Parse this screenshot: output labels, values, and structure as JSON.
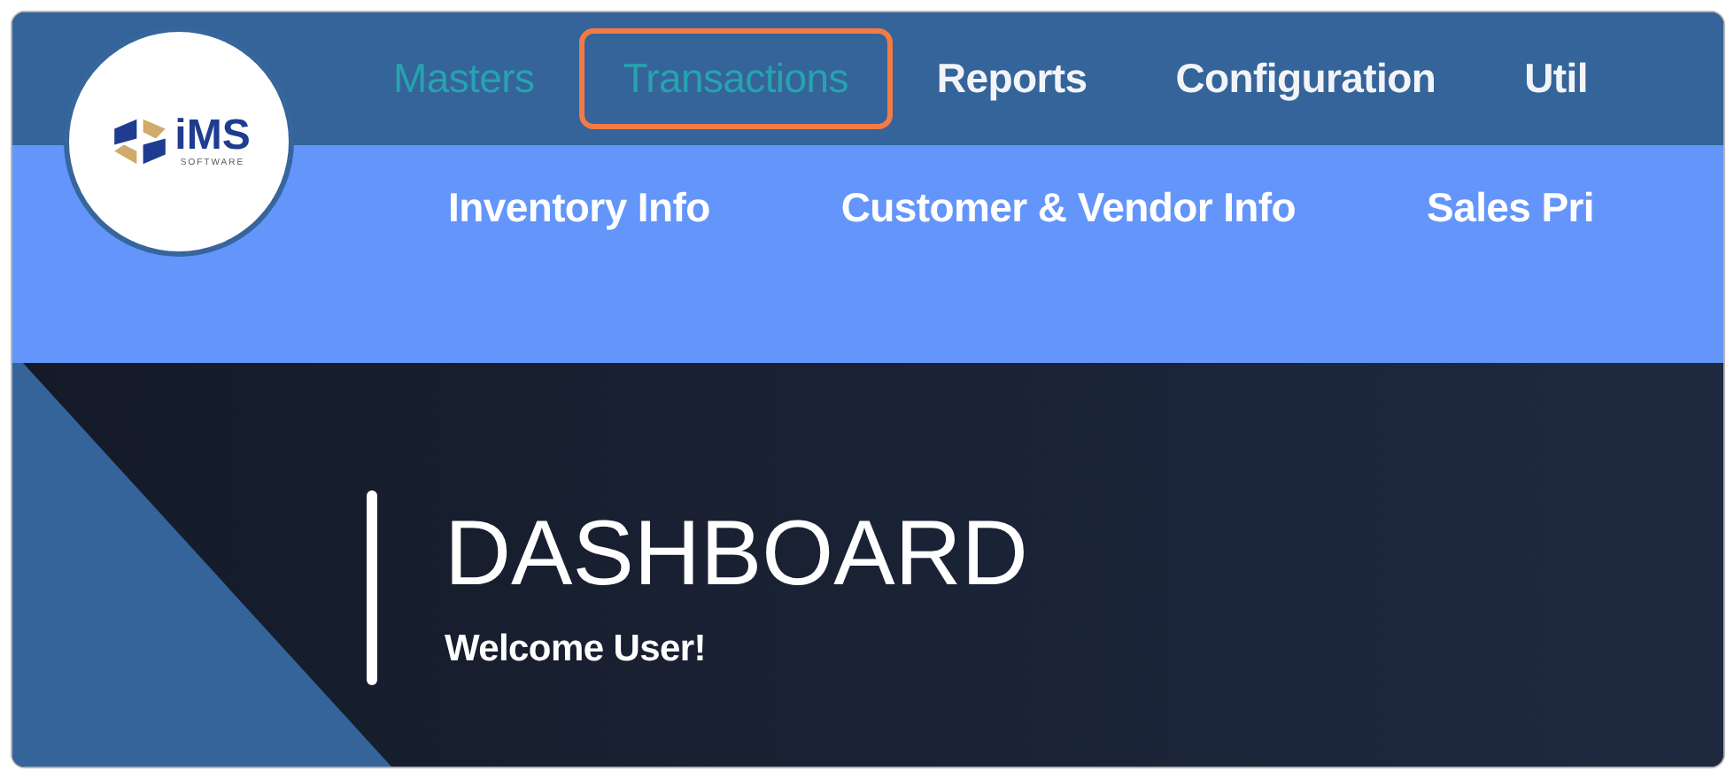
{
  "logo": {
    "name": "iMS",
    "tagline": "SOFTWARE"
  },
  "main_nav": [
    {
      "label": "Masters",
      "selected": true,
      "hovered": false,
      "highlighted": false
    },
    {
      "label": "Transactions",
      "selected": false,
      "hovered": true,
      "highlighted": true
    },
    {
      "label": "Reports",
      "selected": false,
      "hovered": false,
      "highlighted": false
    },
    {
      "label": "Configuration",
      "selected": false,
      "hovered": false,
      "highlighted": false
    },
    {
      "label": "Util",
      "selected": false,
      "hovered": false,
      "highlighted": false
    }
  ],
  "sub_nav": [
    {
      "label": "Inventory Info"
    },
    {
      "label": "Customer & Vendor Info"
    },
    {
      "label": "Sales Pri"
    }
  ],
  "page": {
    "title": "DASHBOARD",
    "subtitle": "Welcome User!"
  }
}
